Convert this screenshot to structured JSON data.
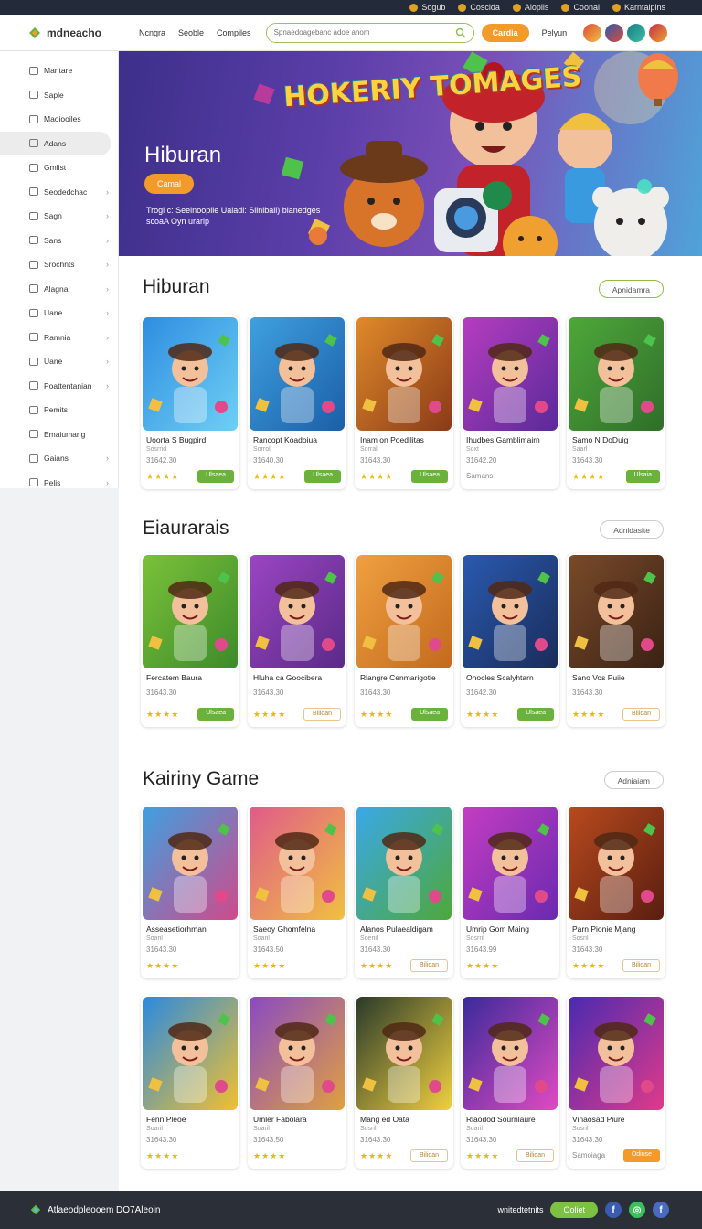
{
  "topbar": {
    "items": [
      "Sogub",
      "Coscida",
      "Alopiis",
      "Coonal",
      "Karntaipins"
    ]
  },
  "header": {
    "logo": "mdneacho",
    "nav": [
      "Ncngra",
      "Seoble",
      "Compiles"
    ],
    "search_placeholder": "Spnaedoagebanc adoe anom",
    "button": "Cardia",
    "link": "Pelyun"
  },
  "sidebar": {
    "items": [
      {
        "label": "Mantare",
        "chevron": false,
        "active": false
      },
      {
        "label": "Saple",
        "chevron": false,
        "active": false
      },
      {
        "label": "Maoiooiles",
        "chevron": false,
        "active": false
      },
      {
        "label": "Adans",
        "chevron": false,
        "active": true
      },
      {
        "label": "Gmlist",
        "chevron": false,
        "active": false
      },
      {
        "label": "Seodedchac",
        "chevron": true,
        "active": false
      },
      {
        "label": "Sagn",
        "chevron": true,
        "active": false
      },
      {
        "label": "Sans",
        "chevron": true,
        "active": false
      },
      {
        "label": "Srochnts",
        "chevron": true,
        "active": false
      },
      {
        "label": "Alagna",
        "chevron": true,
        "active": false
      },
      {
        "label": "Uane",
        "chevron": true,
        "active": false
      },
      {
        "label": "Ramnia",
        "chevron": true,
        "active": false
      },
      {
        "label": "Uane",
        "chevron": true,
        "active": false
      },
      {
        "label": "Poattentanian",
        "chevron": true,
        "active": false
      },
      {
        "label": "Pemits",
        "chevron": false,
        "active": false
      },
      {
        "label": "Emaiumang",
        "chevron": false,
        "active": false
      },
      {
        "label": "Gaians",
        "chevron": true,
        "active": false
      },
      {
        "label": "Pelis",
        "chevron": true,
        "active": false
      }
    ]
  },
  "hero": {
    "title": "Hiburan",
    "button": "Camal",
    "subtitle": "Trogi c: Seeinooplie Ualadi: Slinibail) bianedges scoaA Oyn urarip",
    "game_title": "HOKERIY TOMAGES"
  },
  "sections": [
    {
      "title": "Hiburan",
      "button": "Apnidamra",
      "cards": [
        {
          "title": "Uoorta S Bugpird",
          "cat": "Sosrrid",
          "price": "31642.30",
          "stars": "★★★★",
          "btn": "Ulsaea",
          "btnStyle": "green",
          "colors": [
            "#2f8de0",
            "#6dd0f5"
          ]
        },
        {
          "title": "Rancopt Koadoiua",
          "cat": "Sorrol",
          "price": "31640.30",
          "stars": "★★★★",
          "btn": "Ulsaea",
          "btnStyle": "green",
          "colors": [
            "#3fa0e0",
            "#1b5fa8"
          ]
        },
        {
          "title": "Inam on Poedilitas",
          "cat": "Sorral",
          "price": "31643.30",
          "stars": "★★★★",
          "btn": "Ulsaea",
          "btnStyle": "green",
          "colors": [
            "#e08a2a",
            "#8a3a18"
          ]
        },
        {
          "title": "Ihudbes Gamblimairn",
          "cat": "Soxt",
          "price": "31642.20",
          "stars": "Samans",
          "btn": "",
          "btnStyle": "none",
          "colors": [
            "#b63dbf",
            "#5a2a9a"
          ]
        },
        {
          "title": "Samo N DoDuig",
          "cat": "Saarl",
          "price": "31643.30",
          "stars": "★★★★",
          "btn": "Ulsaia",
          "btnStyle": "green",
          "colors": [
            "#4ea83a",
            "#2f6e2a"
          ]
        }
      ]
    },
    {
      "title": "Eiaurarais",
      "button": "Adnldasite",
      "cards": [
        {
          "title": "Fercatem Baura",
          "cat": "",
          "price": "31643.30",
          "stars": "★★★★",
          "btn": "Ulsaea",
          "btnStyle": "green",
          "colors": [
            "#7ac23a",
            "#3d8a2a"
          ]
        },
        {
          "title": "Hluha ca Goocibera",
          "cat": "",
          "price": "31643.30",
          "stars": "★★★★",
          "btn": "Bilidan",
          "btnStyle": "outline",
          "colors": [
            "#9b45c2",
            "#5a2a88"
          ]
        },
        {
          "title": "Rlangre Cenmarigotie",
          "cat": "",
          "price": "31643.30",
          "stars": "★★★★",
          "btn": "Ulsaea",
          "btnStyle": "green",
          "colors": [
            "#f0a040",
            "#c26a1e"
          ]
        },
        {
          "title": "Onocles Scalyhtarn",
          "cat": "",
          "price": "31642.30",
          "stars": "★★★★",
          "btn": "Ulsaea",
          "btnStyle": "green",
          "colors": [
            "#2a5ab0",
            "#1a2c5a"
          ]
        },
        {
          "title": "Sano Vos Puiie",
          "cat": "",
          "price": "31643.30",
          "stars": "★★★★",
          "btn": "Bilidan",
          "btnStyle": "outline",
          "colors": [
            "#7a4a2a",
            "#3a2214"
          ]
        }
      ]
    },
    {
      "title": "Kairiny Game",
      "button": "Adniaiam",
      "cards": [
        {
          "title": "Asseasetiorhman",
          "cat": "Soaril",
          "price": "31643.30",
          "stars": "★★★★",
          "btn": "",
          "btnStyle": "none",
          "colors": [
            "#3ea0e0",
            "#d04a8a"
          ]
        },
        {
          "title": "Saeoy Ghomfelna",
          "cat": "Soaril",
          "price": "31643.50",
          "stars": "★★★★",
          "btn": "",
          "btnStyle": "none",
          "colors": [
            "#e05a8a",
            "#f0c040"
          ]
        },
        {
          "title": "Alanos Pulaealdigam",
          "cat": "Soeriil",
          "price": "31643.30",
          "stars": "★★★★",
          "btn": "Bilidan",
          "btnStyle": "outline",
          "colors": [
            "#3aa8e8",
            "#4ea83a"
          ]
        },
        {
          "title": "Umrip Gom Maing",
          "cat": "Sosrril",
          "price": "31643.99",
          "stars": "★★★★",
          "btn": "",
          "btnStyle": "none",
          "colors": [
            "#c43dc2",
            "#6a2ab0"
          ]
        },
        {
          "title": "Parn Pionie Mjang",
          "cat": "Sosril",
          "price": "31643.30",
          "stars": "★★★★",
          "btn": "Bilidan",
          "btnStyle": "outline",
          "colors": [
            "#b84a1e",
            "#5a1e10"
          ]
        }
      ]
    },
    {
      "title": "",
      "button": "",
      "cards": [
        {
          "title": "Fenn Pleoe",
          "cat": "Soaril",
          "price": "31643.30",
          "stars": "★★★★",
          "btn": "",
          "btnStyle": "none",
          "colors": [
            "#2a8ae0",
            "#f0c030"
          ]
        },
        {
          "title": "Umler Fabolara",
          "cat": "Soaril",
          "price": "31643.50",
          "stars": "★★★★",
          "btn": "",
          "btnStyle": "none",
          "colors": [
            "#8a4ac2",
            "#e0a040"
          ]
        },
        {
          "title": "Mang ed Oata",
          "cat": "Sosril",
          "price": "31643.30",
          "stars": "★★★★",
          "btn": "Bilidan",
          "btnStyle": "outline",
          "colors": [
            "#2a3a2a",
            "#f0d040"
          ]
        },
        {
          "title": "Rlaodod Sournlaure",
          "cat": "Soaril",
          "price": "31643.30",
          "stars": "★★★★",
          "btn": "Bilidan",
          "btnStyle": "outline",
          "colors": [
            "#3a2a9a",
            "#e04ac2"
          ]
        },
        {
          "title": "Vinaosad Piure",
          "cat": "Sosril",
          "price": "31643.30",
          "stars": "Samoiaga",
          "btn": "Odiuse",
          "btnStyle": "orange",
          "colors": [
            "#4a2ab0",
            "#e03a8a"
          ]
        }
      ]
    }
  ],
  "footer": {
    "left": "Atlaeodpleooem DO7Aleoin",
    "right_text": "wnitedtetnits",
    "button": "Ooliet"
  },
  "colors": {
    "accent_green": "#8cbf43",
    "accent_orange": "#f29b2b",
    "topbar": "#232a3a",
    "footer": "#2a2f38"
  }
}
